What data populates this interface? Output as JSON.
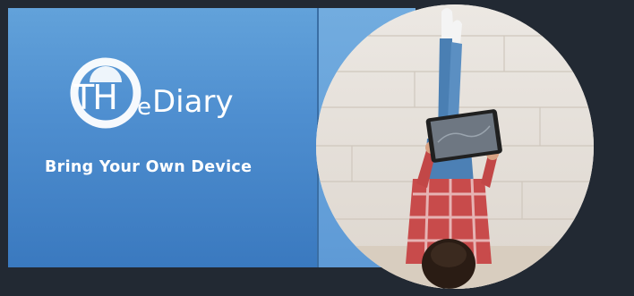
{
  "banner": {
    "logo": {
      "part_th": "TH",
      "part_e": "e",
      "part_diary": "Diary"
    },
    "tagline": "Bring Your Own Device",
    "photo": {
      "subject": "woman-lying-with-tablet-legs-up-wall"
    },
    "colors": {
      "background": "#222933",
      "panel_top": "#62a2da",
      "panel_bottom": "#3a79bf",
      "text": "#ffffff"
    }
  }
}
